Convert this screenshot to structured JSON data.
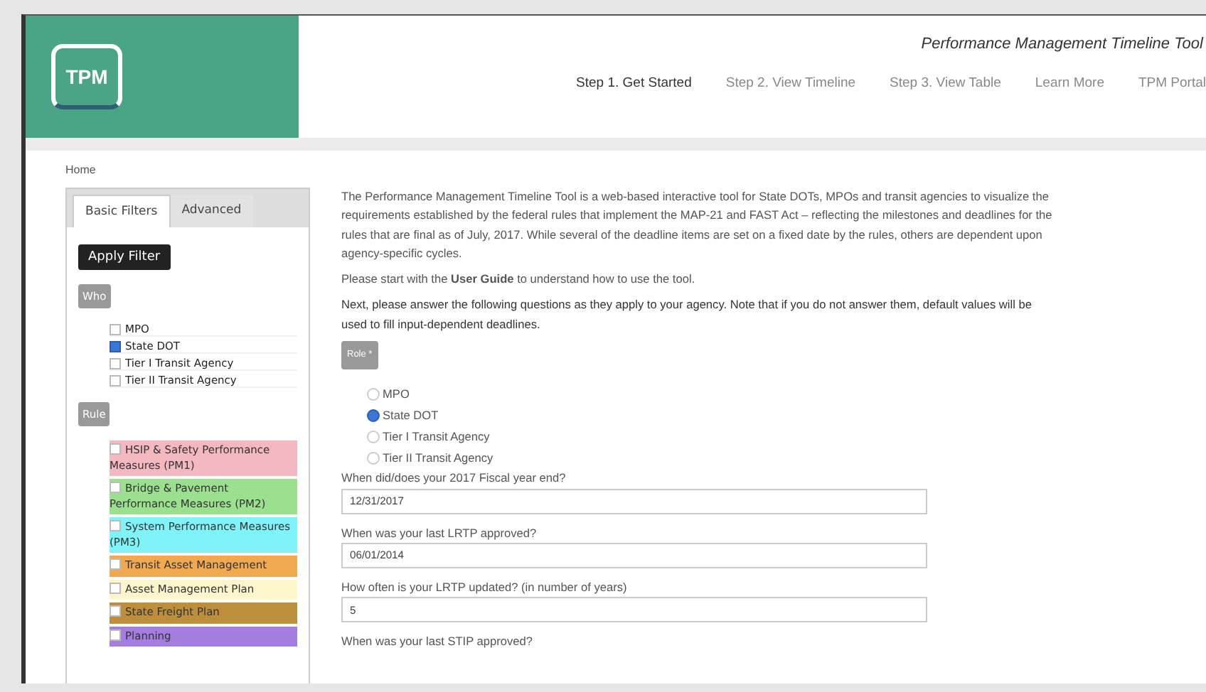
{
  "header": {
    "logo": "TPM",
    "title": "Performance Management Timeline Tool",
    "nav": [
      {
        "label": "Step 1. Get Started",
        "selected": true
      },
      {
        "label": "Step 2. View Timeline",
        "selected": false
      },
      {
        "label": "Step 3. View Table",
        "selected": false
      },
      {
        "label": "Learn More",
        "selected": false
      },
      {
        "label": "TPM Portal",
        "selected": false
      }
    ]
  },
  "breadcrumb": "Home",
  "sidebar": {
    "tabs": [
      {
        "label": "Basic Filters",
        "selected": true
      },
      {
        "label": "Advanced",
        "selected": false
      }
    ],
    "apply_button": "Apply Filter",
    "who_label": "Who",
    "who": [
      {
        "label": "MPO",
        "checked": false
      },
      {
        "label": "State DOT",
        "checked": true
      },
      {
        "label": "Tier I Transit Agency",
        "checked": false
      },
      {
        "label": "Tier II Transit Agency",
        "checked": false
      }
    ],
    "rule_label": "Rule",
    "rules": [
      {
        "label": "HSIP & Safety Performance Measures (PM1)",
        "checked": false,
        "color": "#f4b8c0"
      },
      {
        "label": "Bridge & Pavement Performance Measures (PM2)",
        "checked": false,
        "color": "#9be08f"
      },
      {
        "label": "System Performance Measures (PM3)",
        "checked": false,
        "color": "#7ff3f7"
      },
      {
        "label": "Transit Asset Management",
        "checked": false,
        "color": "#f0a94e"
      },
      {
        "label": "Asset Management Plan",
        "checked": false,
        "color": "#fdf6cc"
      },
      {
        "label": "State Freight Plan",
        "checked": false,
        "color": "#bd8f3c"
      },
      {
        "label": "Planning",
        "checked": false,
        "color": "#a37ee0"
      }
    ]
  },
  "intro": "The Performance Management Timeline Tool is a web-based interactive tool for State DOTs, MPOs and transit agencies to visualize the requirements established by the federal rules that implement the MAP-21 and FAST Act – reflecting the milestones and deadlines for the rules that are final as of July, 2017. While several of the deadline items are set on a fixed date by the rules, others are dependent upon agency-specific cycles.",
  "guide_text": "Please start with the **User Guide** to understand how to use the tool.",
  "next_text": "Next, please answer the following questions as they apply to your agency. Note that if you do not answer them, default values will be used to fill input-dependent deadlines.",
  "role_label": "Role *",
  "roles": [
    {
      "label": "MPO",
      "selected": false
    },
    {
      "label": "State DOT",
      "selected": true
    },
    {
      "label": "Tier I Transit Agency",
      "selected": false
    },
    {
      "label": "Tier II Transit Agency",
      "selected": false
    }
  ],
  "questions": [
    {
      "label": "When did/does your 2017 Fiscal year end?",
      "value": "12/31/2017"
    },
    {
      "label": "When was your last LRTP approved?",
      "value": "06/01/2014"
    },
    {
      "label": "How often is your LRTP updated? (in number of years)",
      "value": "5"
    },
    {
      "label": "When was your last STIP approved?"
    }
  ]
}
